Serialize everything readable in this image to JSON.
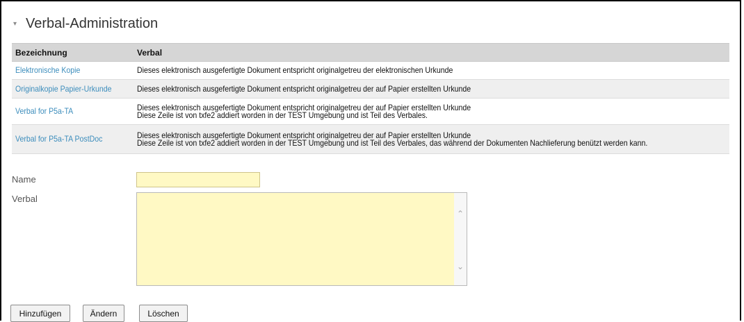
{
  "section": {
    "title": "Verbal-Administration",
    "collapse_icon": "triangle-down-icon"
  },
  "table": {
    "headers": [
      "Bezeichnung",
      "Verbal"
    ],
    "rows": [
      {
        "name": "Elektronische Kopie",
        "verbal_line1": "Dieses elektronisch ausgefertigte Dokument entspricht originalgetreu der elektronischen Urkunde",
        "verbal_line2": ""
      },
      {
        "name": "Originalkopie Papier-Urkunde",
        "verbal_line1": "Dieses elektronisch ausgefertigte Dokument entspricht originalgetreu der auf Papier erstellten Urkunde",
        "verbal_line2": ""
      },
      {
        "name": "Verbal for P5a-TA",
        "verbal_line1": "Dieses elektronisch ausgefertigte Dokument entspricht originalgetreu der auf Papier erstellten Urkunde",
        "verbal_line2": "Diese Zeile ist von txfe2 addiert worden in der TEST Umgebung und ist Teil des Verbales."
      },
      {
        "name": "Verbal for P5a-TA PostDoc",
        "verbal_line1": "Dieses elektronisch ausgefertigte Dokument entspricht originalgetreu der auf Papier erstellten Urkunde",
        "verbal_line2": "Diese Zeile ist von txfe2 addiert worden in der TEST Umgebung und ist Teil des Verbales, das während der Dokumenten Nachlieferung benützt werden kann."
      }
    ],
    "link_color": "#3c8dbc"
  },
  "form": {
    "name_label": "Name",
    "name_value": "",
    "verbal_label": "Verbal",
    "verbal_value": "",
    "field_bg_color": "#fff9c4"
  },
  "buttons": {
    "add": "Hinzufügen",
    "edit": "Ändern",
    "delete": "Löschen"
  }
}
